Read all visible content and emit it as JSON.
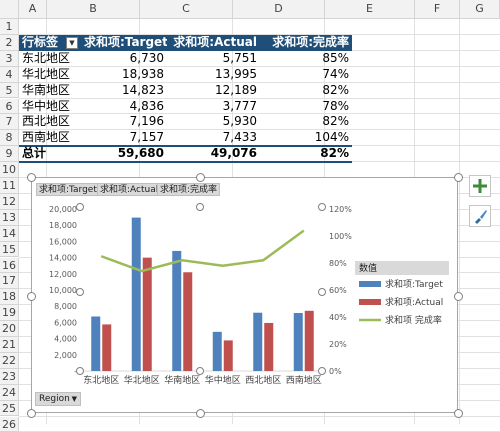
{
  "columns": [
    "A",
    "B",
    "C",
    "D",
    "E",
    "F",
    "G"
  ],
  "rows": [
    "1",
    "2",
    "3",
    "4",
    "5",
    "6",
    "7",
    "8",
    "9",
    "10",
    "11",
    "12",
    "13",
    "14",
    "15",
    "16",
    "17",
    "18",
    "19",
    "20",
    "21",
    "22",
    "23",
    "24",
    "25",
    "26"
  ],
  "pivot": {
    "header": [
      "行标签",
      "求和项:Target",
      "求和项:Actual",
      "求和项:完成率"
    ],
    "rows": [
      [
        "东北地区",
        "6,730",
        "5,751",
        "85%"
      ],
      [
        "华北地区",
        "18,938",
        "13,995",
        "74%"
      ],
      [
        "华南地区",
        "14,823",
        "12,189",
        "82%"
      ],
      [
        "华中地区",
        "4,836",
        "3,777",
        "78%"
      ],
      [
        "西北地区",
        "7,196",
        "5,930",
        "82%"
      ],
      [
        "西南地区",
        "7,157",
        "7,433",
        "104%"
      ]
    ],
    "total": [
      "总计",
      "59,680",
      "49,076",
      "82%"
    ]
  },
  "chart": {
    "field_buttons": [
      "求和项:Target",
      "求和项:Actual",
      "求和项:完成率"
    ],
    "axis_field_button": "Region",
    "legend_title": "数值",
    "tool_buttons": [
      "plus-icon",
      "brush-icon"
    ],
    "colors": {
      "target": "#4f81bd",
      "actual": "#c0504d",
      "rate": "#9bbb59",
      "header": "#1f4e79"
    }
  },
  "chart_data": {
    "type": "bar",
    "categories": [
      "东北地区",
      "华北地区",
      "华南地区",
      "华中地区",
      "西北地区",
      "西南地区"
    ],
    "series": [
      {
        "name": "求和项:Target",
        "values": [
          6730,
          18938,
          14823,
          4836,
          7196,
          7157
        ]
      },
      {
        "name": "求和项:Actual",
        "values": [
          5751,
          13995,
          12189,
          3777,
          5930,
          7433
        ]
      },
      {
        "name": "求和项:完成率",
        "type": "line",
        "axis": "right",
        "values": [
          85,
          74,
          82,
          78,
          82,
          104
        ]
      }
    ],
    "y_ticks": [
      "20,000",
      "18,000",
      "16,000",
      "14,000",
      "12,000",
      "10,000",
      "8,000",
      "6,000",
      "4,000",
      "2,000",
      "-"
    ],
    "y2_ticks": [
      "120%",
      "100%",
      "80%",
      "60%",
      "40%",
      "20%",
      "0%"
    ],
    "ylim": [
      0,
      20000
    ],
    "y2lim": [
      0,
      120
    ],
    "legend_position": "right",
    "grid": false
  }
}
